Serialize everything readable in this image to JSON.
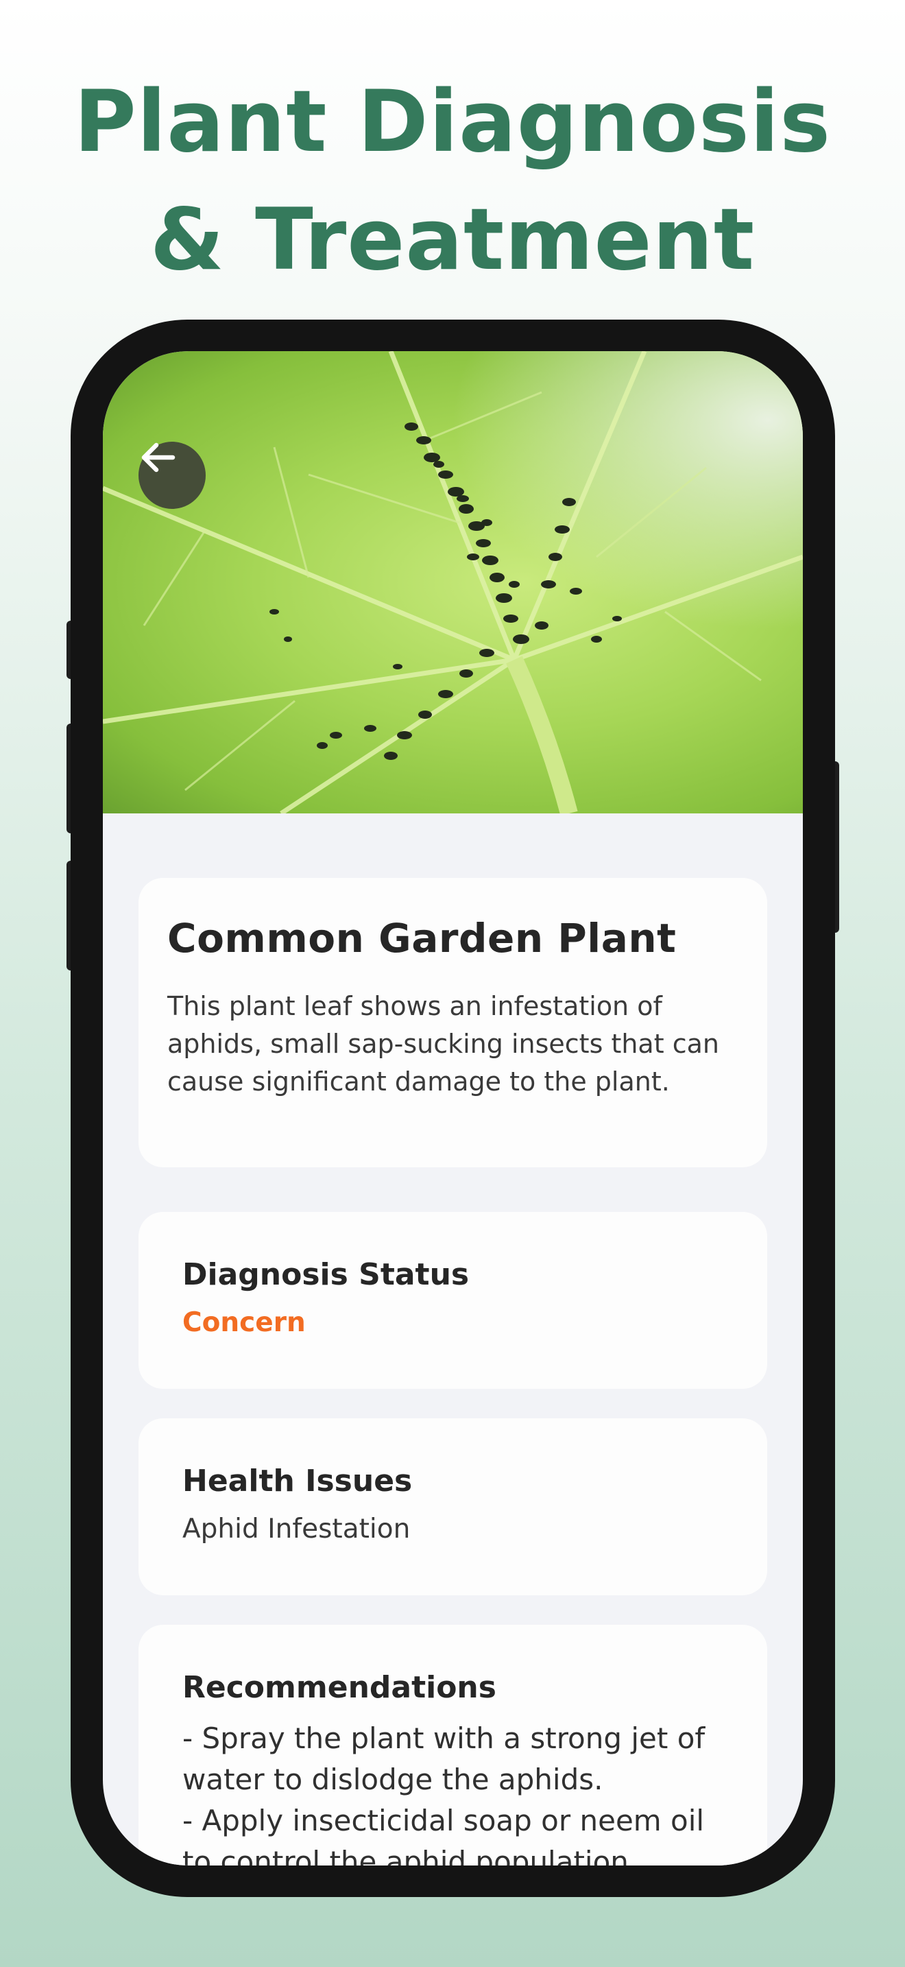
{
  "headline": {
    "line1": "Plant Diagnosis",
    "line2": "& Treatment"
  },
  "plant": {
    "name": "Common Garden Plant",
    "description": "This plant leaf shows an infestation of aphids, small sap-sucking insects that can cause significant damage to the plant."
  },
  "diagnosis": {
    "title": "Diagnosis Status",
    "value": "Concern",
    "value_color": "#f26c22"
  },
  "health": {
    "title": "Health Issues",
    "value": "Aphid Infestation"
  },
  "recommendations": {
    "title": "Recommendations",
    "items": [
      "- Spray the plant with a strong jet of water to dislodge the aphids.",
      "- Apply insecticidal soap or neem oil to control the aphid population."
    ]
  },
  "icons": {
    "back": "arrow-left-icon"
  },
  "colors": {
    "brand": "#357a5c",
    "status_concern": "#f26c22"
  }
}
